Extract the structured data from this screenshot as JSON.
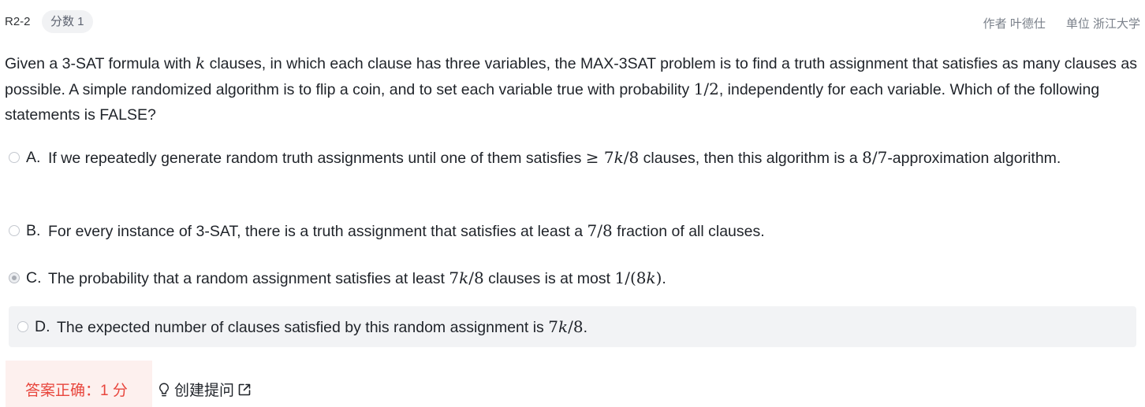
{
  "header": {
    "question_id": "R2-2",
    "score_badge": "分数 1",
    "author": "作者 叶德仕",
    "unit": "单位 浙江大学"
  },
  "question": {
    "p1": "Given a 3-SAT formula with ",
    "m1": "k",
    "p2": " clauses, in which each clause has three variables, the MAX-3SAT problem is to find a truth assignment that satisfies as many clauses as possible. A simple randomized algorithm is to flip a coin, and to set each variable true with probability ",
    "m2": "1/2",
    "p3": ", independently for each variable. Which of the following statements is FALSE?"
  },
  "options": [
    {
      "letter": "A.",
      "p1": "If we repeatedly generate random truth assignments until one of them satisfies ",
      "m1": "≥ 7",
      "m1k": "k",
      "m1b": "/8",
      "p2": " clauses, then this algorithm is a ",
      "m2": "8/7",
      "p3": "-approximation algorithm.",
      "selected": false
    },
    {
      "letter": "B.",
      "p1": "For every instance of 3-SAT, there is a truth assignment that satisfies at least a ",
      "m1": "7/8",
      "p2": " fraction of all clauses.",
      "selected": false
    },
    {
      "letter": "C.",
      "p1": "The probability that a random assignment satisfies at least ",
      "m1": "7",
      "m1k": "k",
      "m1b": "/8",
      "p2": " clauses is at most ",
      "m2": "1/(8",
      "m2k": "k",
      "m2b": ")",
      "p3": ".",
      "selected": true
    },
    {
      "letter": "D.",
      "p1": "The expected number of clauses satisfied by this random assignment is ",
      "m1": "7",
      "m1k": "k",
      "m1b": "/8",
      "p2": ".",
      "selected": false
    }
  ],
  "result": {
    "text": "答案正确：1 分"
  },
  "actions": {
    "create_question": "创建提问"
  },
  "icons": {
    "create_question": "lightbulb-icon",
    "external": "external-link-icon"
  },
  "colors": {
    "result_text": "#e8453c",
    "result_bg": "#fdf0ee",
    "hover_bg": "#f2f3f5"
  }
}
